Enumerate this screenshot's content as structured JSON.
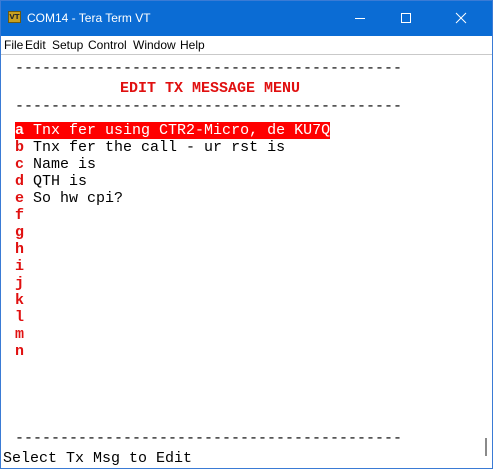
{
  "window": {
    "title": "COM14 - Tera Term VT",
    "app_icon_label": "VT",
    "accent_color": "#0b6cd4"
  },
  "menu": {
    "items": [
      "File",
      "Edit",
      "Setup",
      "Control",
      "Window",
      "Help"
    ]
  },
  "terminal": {
    "divider": "-------------------------------------------",
    "heading": "EDIT TX MESSAGE MENU",
    "selected_key": "a",
    "messages": [
      {
        "key": "a",
        "text": "Tnx fer using CTR2-Micro, de KU7Q"
      },
      {
        "key": "b",
        "text": "Tnx fer the call - ur rst is"
      },
      {
        "key": "c",
        "text": "Name is"
      },
      {
        "key": "d",
        "text": "QTH is"
      },
      {
        "key": "e",
        "text": "So hw cpi?"
      },
      {
        "key": "f",
        "text": ""
      },
      {
        "key": "g",
        "text": ""
      },
      {
        "key": "h",
        "text": ""
      },
      {
        "key": "i",
        "text": ""
      },
      {
        "key": "j",
        "text": ""
      },
      {
        "key": "k",
        "text": ""
      },
      {
        "key": "l",
        "text": ""
      },
      {
        "key": "m",
        "text": ""
      },
      {
        "key": "n",
        "text": ""
      }
    ],
    "prompt": "Select Tx Msg to Edit",
    "highlight_color": "#ff0000",
    "key_color": "#e01010"
  },
  "icons": {
    "minimize": "minimize-icon",
    "maximize": "maximize-icon",
    "close": "close-icon"
  }
}
